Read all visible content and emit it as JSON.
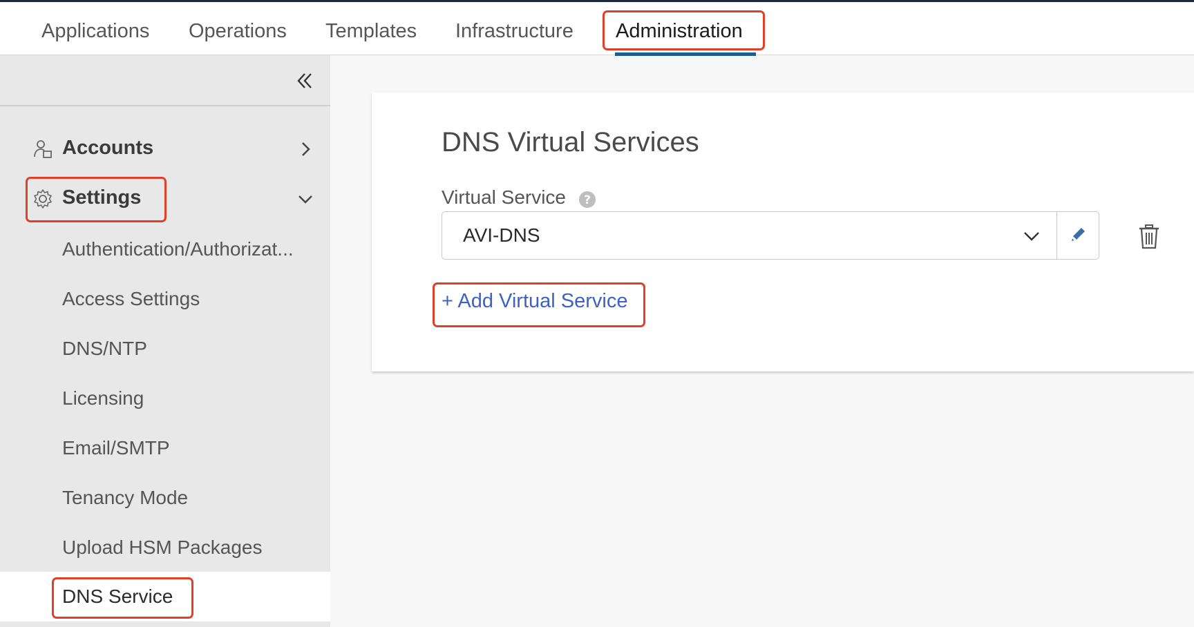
{
  "nav": {
    "tabs": [
      {
        "label": "Applications"
      },
      {
        "label": "Operations"
      },
      {
        "label": "Templates"
      },
      {
        "label": "Infrastructure"
      },
      {
        "label": "Administration",
        "active": true
      }
    ]
  },
  "sidebar": {
    "collapse_icon": "double-chevron-left-icon",
    "groups": [
      {
        "label": "Accounts",
        "icon": "user-accounts-icon",
        "expanded": false
      },
      {
        "label": "Settings",
        "icon": "gear-icon",
        "expanded": true
      }
    ],
    "settings_items": [
      {
        "label": "Authentication/Authorizat..."
      },
      {
        "label": "Access Settings"
      },
      {
        "label": "DNS/NTP"
      },
      {
        "label": "Licensing"
      },
      {
        "label": "Email/SMTP"
      },
      {
        "label": "Tenancy Mode"
      },
      {
        "label": "Upload HSM Packages"
      },
      {
        "label": "DNS Service",
        "active": true
      }
    ]
  },
  "main": {
    "title": "DNS Virtual Services",
    "field_label": "Virtual Service",
    "selected_value": "AVI-DNS",
    "add_link": "+ Add Virtual Service"
  },
  "colors": {
    "highlight": "#e0402a",
    "tab_underline": "#1d5d92",
    "link": "#3d62c4",
    "sidebar_bg": "#e8e8e8"
  }
}
